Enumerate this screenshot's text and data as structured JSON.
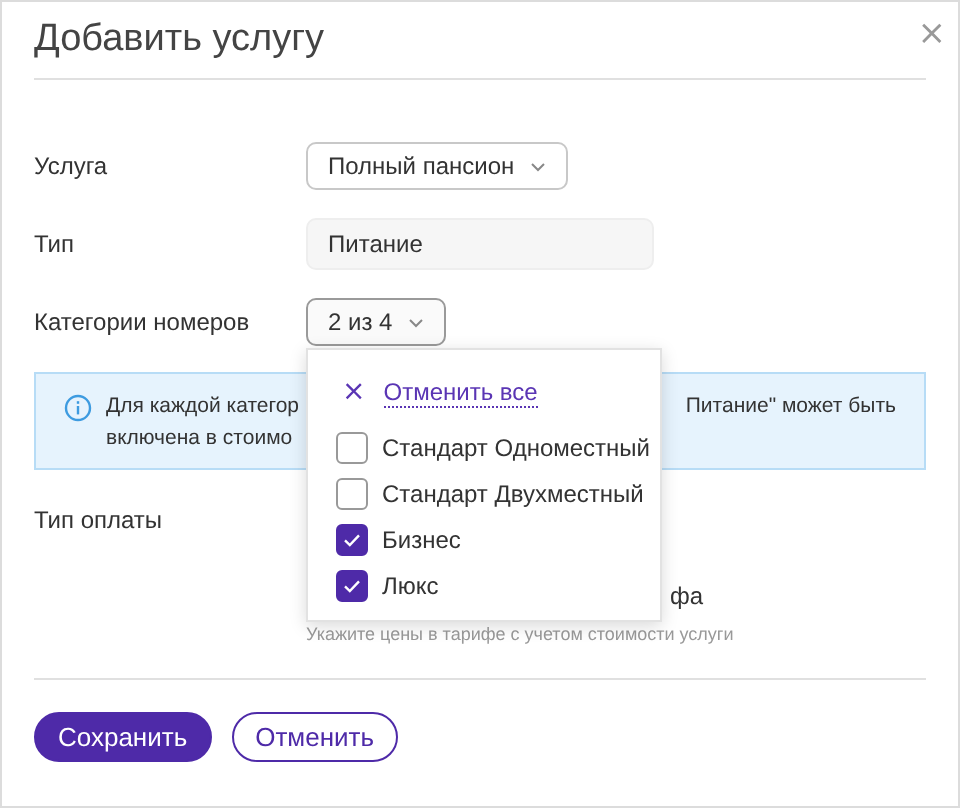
{
  "dialog": {
    "title": "Добавить услугу",
    "close": "×"
  },
  "fields": [
    {
      "kind": "select",
      "label": "Услуга",
      "value": "Полный пансион"
    },
    {
      "kind": "readonly",
      "label": "Тип",
      "value": "Питание"
    },
    {
      "kind": "multiselect",
      "label": "Категории номеров",
      "value": "2 из 4",
      "expanded": true
    }
  ],
  "info": {
    "line1_left": "Для каждой категор",
    "line1_right": "Питание\" может быть",
    "line2": "включена в стоимо"
  },
  "payment": {
    "label": "Тип оплаты",
    "option_fragment": "фа",
    "hint": "Укажите цены в тарифе с учетом стоимости услуги"
  },
  "dropdown": {
    "clear_icon": "×",
    "clear_all": "Отменить все",
    "options": [
      {
        "label": "Стандарт Одноместный",
        "checked": false
      },
      {
        "label": "Стандарт Двухместный",
        "checked": false
      },
      {
        "label": "Бизнес",
        "checked": true
      },
      {
        "label": "Люкс",
        "checked": true
      }
    ]
  },
  "buttons": [
    {
      "kind": "primary",
      "label": "Сохранить"
    },
    {
      "kind": "secondary",
      "label": "Отменить"
    }
  ]
}
